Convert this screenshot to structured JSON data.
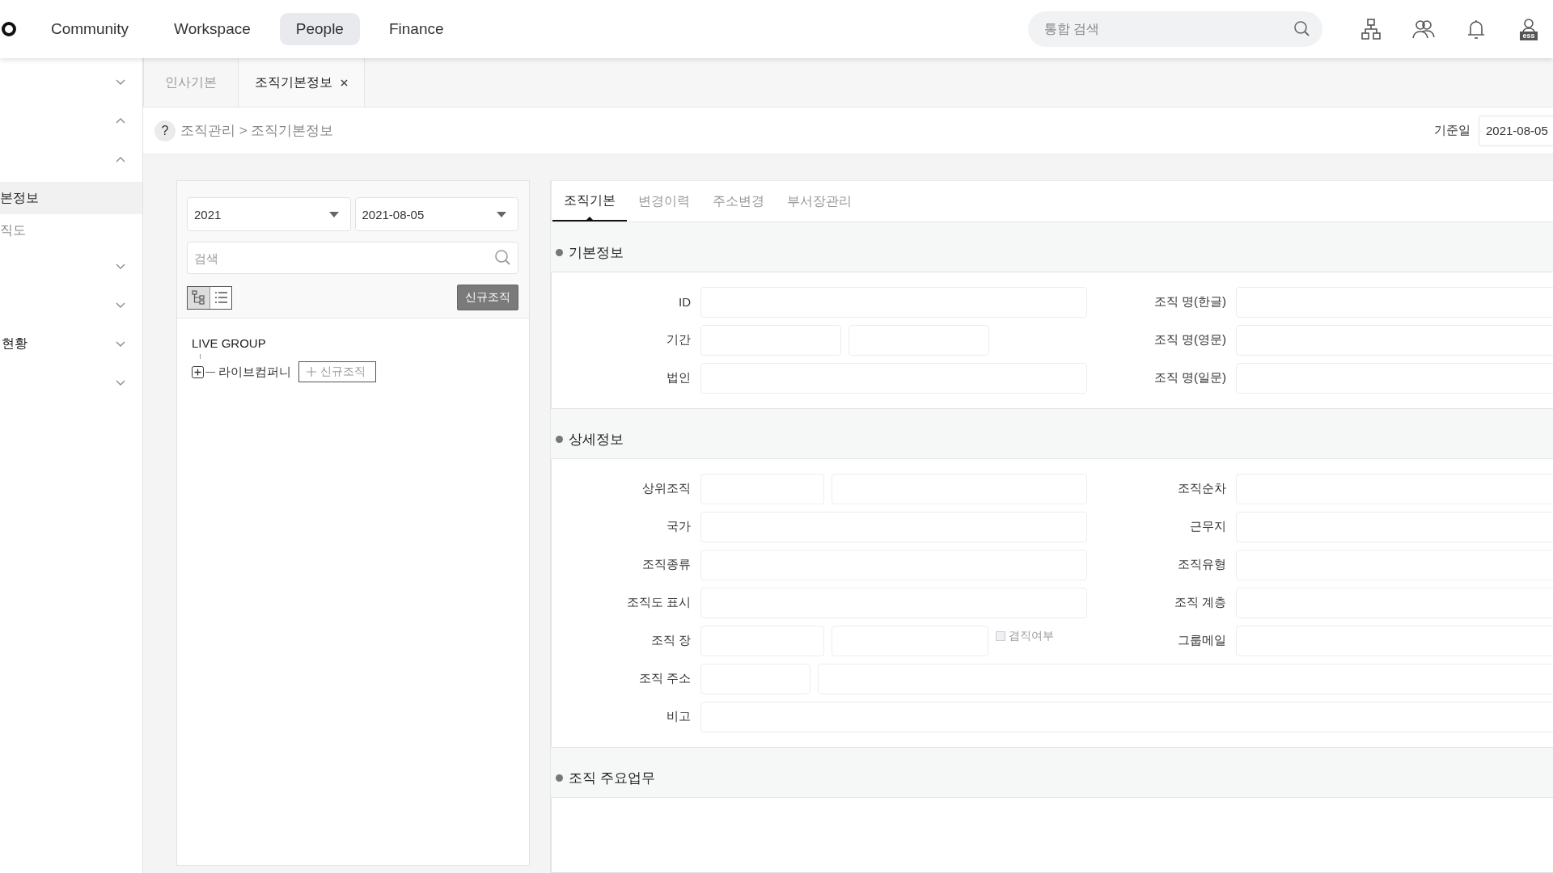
{
  "top_nav": {
    "items": [
      {
        "label": "Community",
        "selected": false
      },
      {
        "label": "Workspace",
        "selected": false
      },
      {
        "label": "People",
        "selected": true
      },
      {
        "label": "Finance",
        "selected": false
      }
    ],
    "search": {
      "placeholder": "통합 검색"
    },
    "profile_badge": "ess"
  },
  "sidebar": {
    "items": [
      {
        "kind": "group",
        "expanded": false
      },
      {
        "kind": "group",
        "expanded": true
      },
      {
        "kind": "group",
        "expanded": true
      },
      {
        "kind": "link",
        "label": "본정보",
        "selected": true
      },
      {
        "kind": "link",
        "label": "직도",
        "selected": false
      },
      {
        "kind": "group",
        "expanded": false
      },
      {
        "kind": "group",
        "expanded": false
      },
      {
        "kind": "group",
        "label": "현황",
        "expanded": false
      },
      {
        "kind": "group",
        "expanded": false
      }
    ]
  },
  "page_tabs": [
    {
      "label": "인사기본",
      "selected": false,
      "closable": false
    },
    {
      "label": "조직기본정보",
      "selected": true,
      "closable": true
    }
  ],
  "breadcrumb": {
    "help": "?",
    "path": "조직관리 > 조직기본정보"
  },
  "base_date": {
    "label": "기준일",
    "value": "2021-08-05"
  },
  "tree_panel": {
    "year_select": "2021",
    "date_select": "2021-08-05",
    "search": {
      "placeholder": "검색"
    },
    "view_modes": [
      {
        "kind": "tree",
        "selected": true
      },
      {
        "kind": "list",
        "selected": false
      }
    ],
    "new_button": "신규조직",
    "tree": [
      {
        "label": "LIVE GROUP",
        "children": [
          {
            "label": "라이브컴퍼니",
            "expanded": false,
            "action": "신규조직"
          }
        ]
      }
    ]
  },
  "detail_tabs": [
    {
      "label": "조직기본",
      "selected": true
    },
    {
      "label": "변경이력",
      "selected": false
    },
    {
      "label": "주소변경",
      "selected": false
    },
    {
      "label": "부서장관리",
      "selected": false
    }
  ],
  "sections": [
    {
      "title": "기본정보",
      "rows": [
        {
          "label": "ID",
          "kind": "single",
          "right_label": "조직 명(한글)"
        },
        {
          "label": "기간",
          "kind": "pair",
          "right_label": "조직 명(영문)"
        },
        {
          "label": "법인",
          "kind": "single",
          "right_label": "조직 명(일문)"
        }
      ]
    },
    {
      "title": "상세정보",
      "rows": [
        {
          "label": "상위조직",
          "kind": "split",
          "right_label": "조직순차"
        },
        {
          "label": "국가",
          "kind": "single",
          "right_label": "근무지"
        },
        {
          "label": "조직종류",
          "kind": "single",
          "right_label": "조직유형"
        },
        {
          "label": "조직도 표시",
          "kind": "single",
          "right_label": "조직 계층"
        },
        {
          "label": "조직 장",
          "kind": "split_check",
          "check": {
            "label": "겸직여부",
            "checked": false,
            "disabled": true
          },
          "right_label": "그룹메일"
        },
        {
          "label": "조직 주소",
          "kind": "address"
        },
        {
          "label": "비고",
          "kind": "full"
        }
      ]
    },
    {
      "title": "조직 주요업무",
      "kind": "textarea"
    }
  ]
}
